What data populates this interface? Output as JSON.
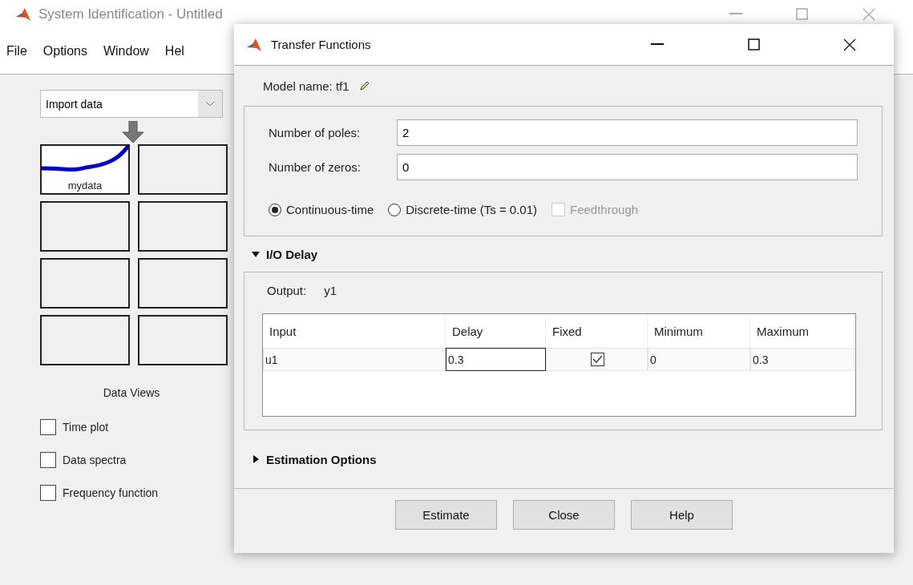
{
  "main_window": {
    "title": "System Identification - Untitled",
    "menu": [
      "File",
      "Options",
      "Window",
      "Hel"
    ],
    "data_source": {
      "value": "Import data"
    },
    "data_tiles": [
      {
        "kind": "data",
        "label": "mydata"
      },
      {
        "kind": "empty"
      },
      {
        "kind": "empty"
      },
      {
        "kind": "empty"
      },
      {
        "kind": "empty"
      },
      {
        "kind": "empty"
      },
      {
        "kind": "empty"
      },
      {
        "kind": "empty"
      }
    ],
    "data_views": {
      "title": "Data Views",
      "options": [
        {
          "label": "Time plot",
          "checked": false
        },
        {
          "label": "Data spectra",
          "checked": false
        },
        {
          "label": "Frequency function",
          "checked": false
        }
      ]
    }
  },
  "dialog": {
    "title": "Transfer Functions",
    "model_name": "Model name: tf1",
    "fields": [
      {
        "label": "Number of poles:",
        "value": "2"
      },
      {
        "label": "Number of zeros:",
        "value": "0"
      }
    ],
    "time_domain": [
      {
        "label": "Continuous-time",
        "selected": true
      },
      {
        "label": "Discrete-time (Ts = 0.01)",
        "selected": false
      }
    ],
    "feedthrough": {
      "label": "Feedthrough",
      "checked": false,
      "disabled": true
    },
    "io_delay": {
      "title": "I/O Delay",
      "expanded": true,
      "output_label": "Output:",
      "output_value": "y1",
      "columns": [
        "Input",
        "Delay",
        "Fixed",
        "Minimum",
        "Maximum"
      ],
      "rows": [
        {
          "input": "u1",
          "delay": "0.3",
          "fixed": true,
          "minimum": "0",
          "maximum": "0.3"
        }
      ]
    },
    "estimation_options": {
      "title": "Estimation Options",
      "expanded": false
    },
    "buttons": [
      "Estimate",
      "Close",
      "Help"
    ]
  }
}
